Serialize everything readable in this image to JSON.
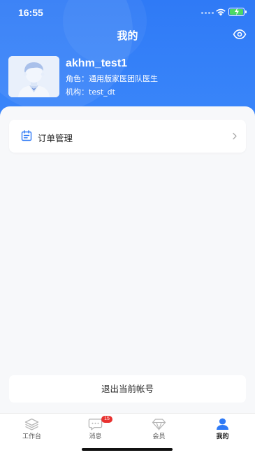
{
  "status_bar": {
    "time": "16:55"
  },
  "nav": {
    "title": "我的",
    "eye_icon": "eye-icon"
  },
  "profile": {
    "name": "akhm_test1",
    "role_label": "角色：",
    "role": "通用版家医团队医生",
    "org_label": "机构：",
    "org": "test_dt"
  },
  "menu": {
    "order_label": "订单管理"
  },
  "logout": {
    "label": "退出当前帐号"
  },
  "tabs": [
    {
      "label": "工作台",
      "icon": "layers-icon"
    },
    {
      "label": "消息",
      "icon": "message-icon",
      "badge": "15"
    },
    {
      "label": "会员",
      "icon": "diamond-icon"
    },
    {
      "label": "我的",
      "icon": "user-icon",
      "active": true
    }
  ],
  "colors": {
    "primary": "#2f7af6",
    "badge": "#e8312f",
    "background": "#f7f8fa"
  }
}
